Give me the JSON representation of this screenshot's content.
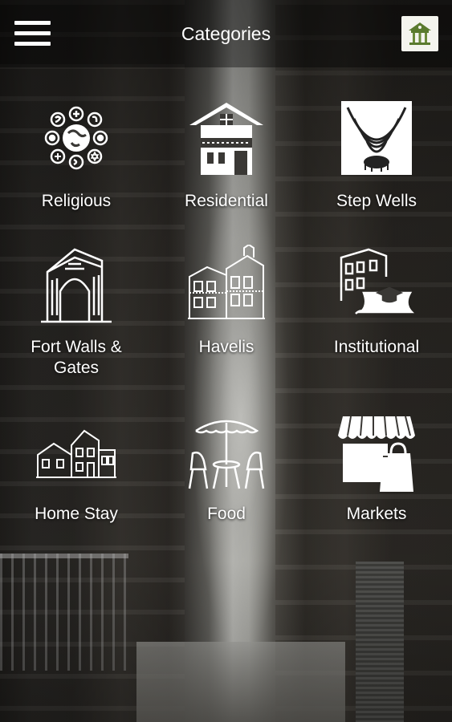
{
  "header": {
    "title": "Categories"
  },
  "categories": [
    {
      "label": "Religious",
      "icon": "religious-symbols-icon"
    },
    {
      "label": "Residential",
      "icon": "house-icon"
    },
    {
      "label": "Step Wells",
      "icon": "step-well-icon"
    },
    {
      "label": "Fort Walls &\nGates",
      "icon": "fort-gate-icon"
    },
    {
      "label": "Havelis",
      "icon": "haveli-icon"
    },
    {
      "label": "Institutional",
      "icon": "institution-icon"
    },
    {
      "label": "Home Stay",
      "icon": "home-stay-icon"
    },
    {
      "label": "Food",
      "icon": "cafe-table-icon"
    },
    {
      "label": "Markets",
      "icon": "market-stall-icon"
    }
  ],
  "colors": {
    "text": "#ffffff",
    "topbar": "#000000",
    "logo_bg": "#f4f4ee",
    "logo_green": "#5a7a2e"
  }
}
